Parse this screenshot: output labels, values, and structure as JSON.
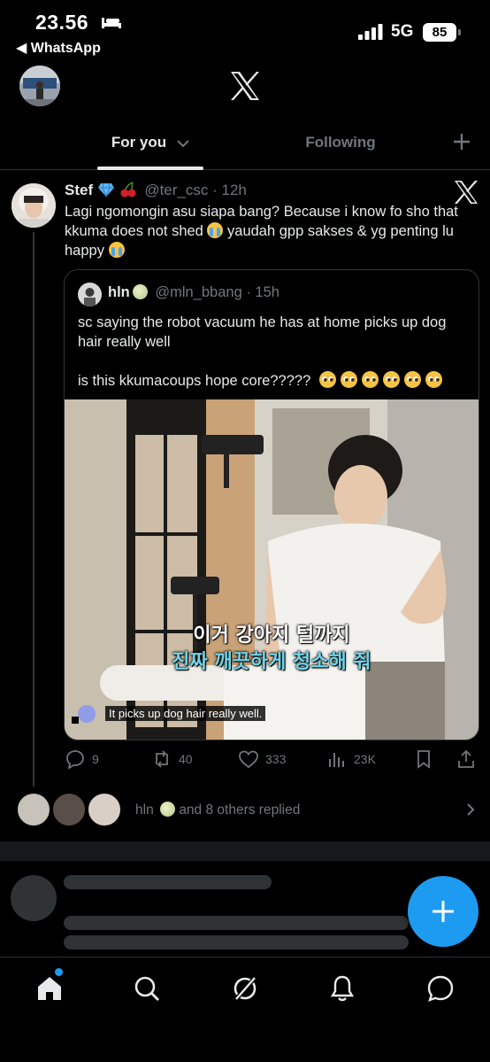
{
  "status_bar": {
    "time": "23.56",
    "back_app": "◀ WhatsApp",
    "network": "5G",
    "battery": "85"
  },
  "tabs": {
    "for_you": "For you",
    "following": "Following"
  },
  "tweet": {
    "author_name": "Stef",
    "author_handle": "@ter_csc",
    "time": "· 12h",
    "text_part1": "Lagi ngomongin asu siapa bang? Because i know fo sho that kkuma does not shed ",
    "text_part2": " yaudah gpp sakses & yg penting lu happy ",
    "quote": {
      "author_name": "hln",
      "author_handle": "@mln_bbang",
      "time": "· 15h",
      "line1": "sc saying the robot vacuum he has at home picks up dog hair really well",
      "line2": "is this kkumacoups hope core?????",
      "subtitle_ko_1": "이거 강아지 털까지",
      "subtitle_ko_2": "진짜 깨끗하게 청소해 줘",
      "subtitle_en": "It picks up dog hair really well."
    },
    "actions": {
      "replies": "9",
      "reposts": "40",
      "likes": "333",
      "views": "23K"
    }
  },
  "replies_row": {
    "lead": "hln",
    "text": "and 8 others replied"
  },
  "colors": {
    "accent": "#1d9bf0",
    "background": "#000000",
    "text_primary": "#e7e9ea",
    "text_secondary": "#71767b",
    "border": "#2f3336"
  }
}
